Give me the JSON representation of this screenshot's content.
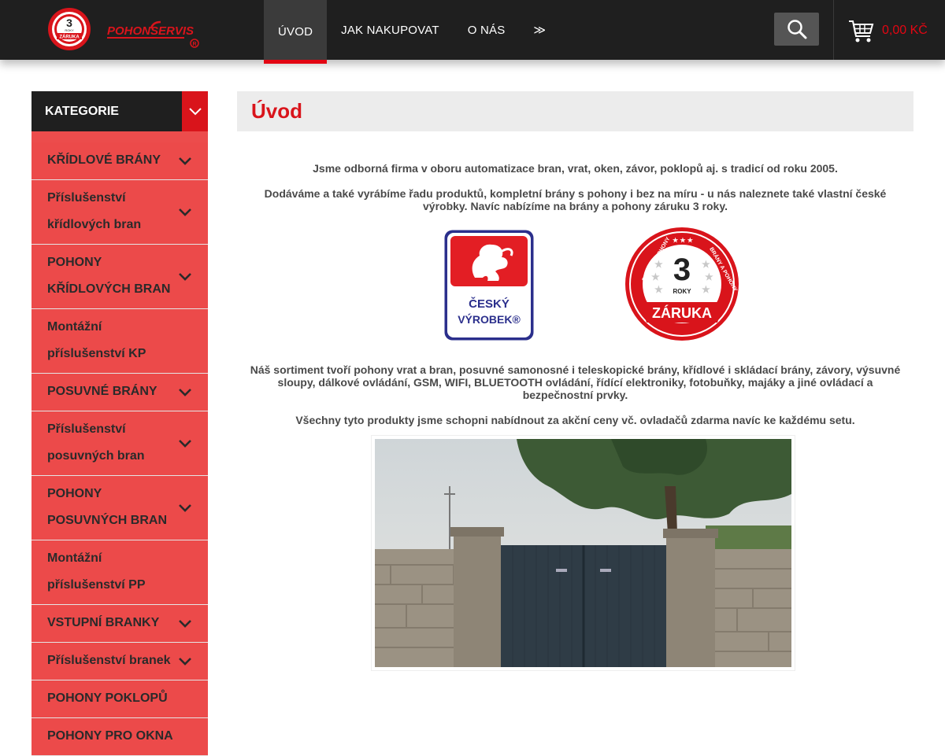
{
  "header": {
    "logo_badge_top": "3",
    "logo_badge_small": "ROKY",
    "logo_badge_bottom": "ZÁRUKA",
    "logo_text": "POHONSERVIS",
    "nav": [
      {
        "label": "Úvod"
      },
      {
        "label": "Jak nakupovat"
      },
      {
        "label": "O nás"
      },
      {
        "label": "≫"
      }
    ],
    "cart_total": "0,00 Kč",
    "icons": {
      "search": "search-icon",
      "cart": "cart-icon"
    }
  },
  "sidebar": {
    "title": "KATEGORIE",
    "items": [
      {
        "label": "KŘÍDLOVÉ BRÁNY",
        "has_sub": true
      },
      {
        "label": "Příslušenství křídlových bran",
        "has_sub": true
      },
      {
        "label": "POHONY KŘÍDLOVÝCH BRAN",
        "has_sub": true
      },
      {
        "label": "Montážní příslušenství KP",
        "has_sub": false
      },
      {
        "label": "POSUVNÉ BRÁNY",
        "has_sub": true
      },
      {
        "label": "Příslušenství posuvných bran",
        "has_sub": true
      },
      {
        "label": "POHONY POSUVNÝCH BRAN",
        "has_sub": true
      },
      {
        "label": "Montážní příslušenství PP",
        "has_sub": false
      },
      {
        "label": "VSTUPNÍ BRANKY",
        "has_sub": true
      },
      {
        "label": "Příslušenství branek",
        "has_sub": true
      },
      {
        "label": "POHONY POKLOPŮ",
        "has_sub": false
      },
      {
        "label": "POHONY PRO OKNA",
        "has_sub": false
      }
    ]
  },
  "main": {
    "title": "Úvod",
    "paragraphs": [
      "Jsme odborná firma v oboru automatizace bran, vrat, oken, závor, poklopů aj. s tradicí od roku 2005.",
      "Dodáváme a také vyrábíme řadu produktů, kompletní brány s pohony i bez na míru - u nás naleznete také vlastní české výrobky. Navíc nabízíme na brány a pohony záruku 3 roky.",
      "Náš sortiment tvoří pohony vrat a bran, posuvné samonosné i teleskopické brány, křídlové i skládací brány, závory, výsuvné sloupy, dálkové ovládání, GSM, WIFI, BLUETOOTH ovládání, řídící elektroniky, fotobuňky, majáky a jiné ovládací a bezpečnostní prvky.",
      "Všechny tyto produkty jsme schopni nabídnout za akční ceny vč. ovladačů zdarma navíc ke každému setu."
    ],
    "badge_cz_line1": "ČESKÝ",
    "badge_cz_line2": "VÝROBEK®",
    "badge_z_number": "3",
    "badge_z_roky": "ROKY",
    "badge_z_zaruka": "ZÁRUKA",
    "badge_z_arc_left": "BRÁNY A POHONY",
    "badge_z_arc_right": "BRÁNY A POHONY"
  },
  "colors": {
    "brand_red": "#d9141b",
    "dark": "#1f1f1f",
    "sidebar_bg": "#ec4c4c"
  }
}
